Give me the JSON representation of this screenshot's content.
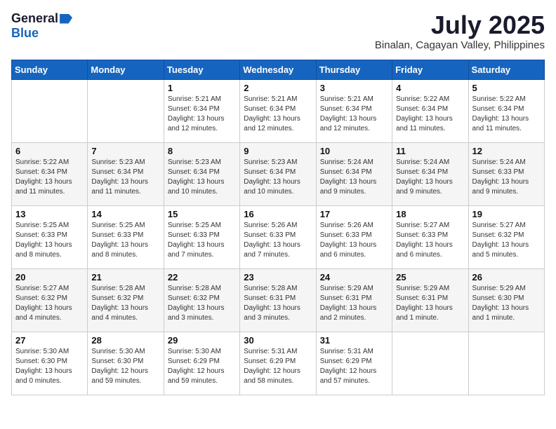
{
  "logo": {
    "general": "General",
    "blue": "Blue"
  },
  "title": "July 2025",
  "location": "Binalan, Cagayan Valley, Philippines",
  "days_of_week": [
    "Sunday",
    "Monday",
    "Tuesday",
    "Wednesday",
    "Thursday",
    "Friday",
    "Saturday"
  ],
  "weeks": [
    [
      {
        "day": "",
        "sunrise": "",
        "sunset": "",
        "daylight": ""
      },
      {
        "day": "",
        "sunrise": "",
        "sunset": "",
        "daylight": ""
      },
      {
        "day": "1",
        "sunrise": "Sunrise: 5:21 AM",
        "sunset": "Sunset: 6:34 PM",
        "daylight": "Daylight: 13 hours and 12 minutes."
      },
      {
        "day": "2",
        "sunrise": "Sunrise: 5:21 AM",
        "sunset": "Sunset: 6:34 PM",
        "daylight": "Daylight: 13 hours and 12 minutes."
      },
      {
        "day": "3",
        "sunrise": "Sunrise: 5:21 AM",
        "sunset": "Sunset: 6:34 PM",
        "daylight": "Daylight: 13 hours and 12 minutes."
      },
      {
        "day": "4",
        "sunrise": "Sunrise: 5:22 AM",
        "sunset": "Sunset: 6:34 PM",
        "daylight": "Daylight: 13 hours and 11 minutes."
      },
      {
        "day": "5",
        "sunrise": "Sunrise: 5:22 AM",
        "sunset": "Sunset: 6:34 PM",
        "daylight": "Daylight: 13 hours and 11 minutes."
      }
    ],
    [
      {
        "day": "6",
        "sunrise": "Sunrise: 5:22 AM",
        "sunset": "Sunset: 6:34 PM",
        "daylight": "Daylight: 13 hours and 11 minutes."
      },
      {
        "day": "7",
        "sunrise": "Sunrise: 5:23 AM",
        "sunset": "Sunset: 6:34 PM",
        "daylight": "Daylight: 13 hours and 11 minutes."
      },
      {
        "day": "8",
        "sunrise": "Sunrise: 5:23 AM",
        "sunset": "Sunset: 6:34 PM",
        "daylight": "Daylight: 13 hours and 10 minutes."
      },
      {
        "day": "9",
        "sunrise": "Sunrise: 5:23 AM",
        "sunset": "Sunset: 6:34 PM",
        "daylight": "Daylight: 13 hours and 10 minutes."
      },
      {
        "day": "10",
        "sunrise": "Sunrise: 5:24 AM",
        "sunset": "Sunset: 6:34 PM",
        "daylight": "Daylight: 13 hours and 9 minutes."
      },
      {
        "day": "11",
        "sunrise": "Sunrise: 5:24 AM",
        "sunset": "Sunset: 6:34 PM",
        "daylight": "Daylight: 13 hours and 9 minutes."
      },
      {
        "day": "12",
        "sunrise": "Sunrise: 5:24 AM",
        "sunset": "Sunset: 6:33 PM",
        "daylight": "Daylight: 13 hours and 9 minutes."
      }
    ],
    [
      {
        "day": "13",
        "sunrise": "Sunrise: 5:25 AM",
        "sunset": "Sunset: 6:33 PM",
        "daylight": "Daylight: 13 hours and 8 minutes."
      },
      {
        "day": "14",
        "sunrise": "Sunrise: 5:25 AM",
        "sunset": "Sunset: 6:33 PM",
        "daylight": "Daylight: 13 hours and 8 minutes."
      },
      {
        "day": "15",
        "sunrise": "Sunrise: 5:25 AM",
        "sunset": "Sunset: 6:33 PM",
        "daylight": "Daylight: 13 hours and 7 minutes."
      },
      {
        "day": "16",
        "sunrise": "Sunrise: 5:26 AM",
        "sunset": "Sunset: 6:33 PM",
        "daylight": "Daylight: 13 hours and 7 minutes."
      },
      {
        "day": "17",
        "sunrise": "Sunrise: 5:26 AM",
        "sunset": "Sunset: 6:33 PM",
        "daylight": "Daylight: 13 hours and 6 minutes."
      },
      {
        "day": "18",
        "sunrise": "Sunrise: 5:27 AM",
        "sunset": "Sunset: 6:33 PM",
        "daylight": "Daylight: 13 hours and 6 minutes."
      },
      {
        "day": "19",
        "sunrise": "Sunrise: 5:27 AM",
        "sunset": "Sunset: 6:32 PM",
        "daylight": "Daylight: 13 hours and 5 minutes."
      }
    ],
    [
      {
        "day": "20",
        "sunrise": "Sunrise: 5:27 AM",
        "sunset": "Sunset: 6:32 PM",
        "daylight": "Daylight: 13 hours and 4 minutes."
      },
      {
        "day": "21",
        "sunrise": "Sunrise: 5:28 AM",
        "sunset": "Sunset: 6:32 PM",
        "daylight": "Daylight: 13 hours and 4 minutes."
      },
      {
        "day": "22",
        "sunrise": "Sunrise: 5:28 AM",
        "sunset": "Sunset: 6:32 PM",
        "daylight": "Daylight: 13 hours and 3 minutes."
      },
      {
        "day": "23",
        "sunrise": "Sunrise: 5:28 AM",
        "sunset": "Sunset: 6:31 PM",
        "daylight": "Daylight: 13 hours and 3 minutes."
      },
      {
        "day": "24",
        "sunrise": "Sunrise: 5:29 AM",
        "sunset": "Sunset: 6:31 PM",
        "daylight": "Daylight: 13 hours and 2 minutes."
      },
      {
        "day": "25",
        "sunrise": "Sunrise: 5:29 AM",
        "sunset": "Sunset: 6:31 PM",
        "daylight": "Daylight: 13 hours and 1 minute."
      },
      {
        "day": "26",
        "sunrise": "Sunrise: 5:29 AM",
        "sunset": "Sunset: 6:30 PM",
        "daylight": "Daylight: 13 hours and 1 minute."
      }
    ],
    [
      {
        "day": "27",
        "sunrise": "Sunrise: 5:30 AM",
        "sunset": "Sunset: 6:30 PM",
        "daylight": "Daylight: 13 hours and 0 minutes."
      },
      {
        "day": "28",
        "sunrise": "Sunrise: 5:30 AM",
        "sunset": "Sunset: 6:30 PM",
        "daylight": "Daylight: 12 hours and 59 minutes."
      },
      {
        "day": "29",
        "sunrise": "Sunrise: 5:30 AM",
        "sunset": "Sunset: 6:29 PM",
        "daylight": "Daylight: 12 hours and 59 minutes."
      },
      {
        "day": "30",
        "sunrise": "Sunrise: 5:31 AM",
        "sunset": "Sunset: 6:29 PM",
        "daylight": "Daylight: 12 hours and 58 minutes."
      },
      {
        "day": "31",
        "sunrise": "Sunrise: 5:31 AM",
        "sunset": "Sunset: 6:29 PM",
        "daylight": "Daylight: 12 hours and 57 minutes."
      },
      {
        "day": "",
        "sunrise": "",
        "sunset": "",
        "daylight": ""
      },
      {
        "day": "",
        "sunrise": "",
        "sunset": "",
        "daylight": ""
      }
    ]
  ]
}
